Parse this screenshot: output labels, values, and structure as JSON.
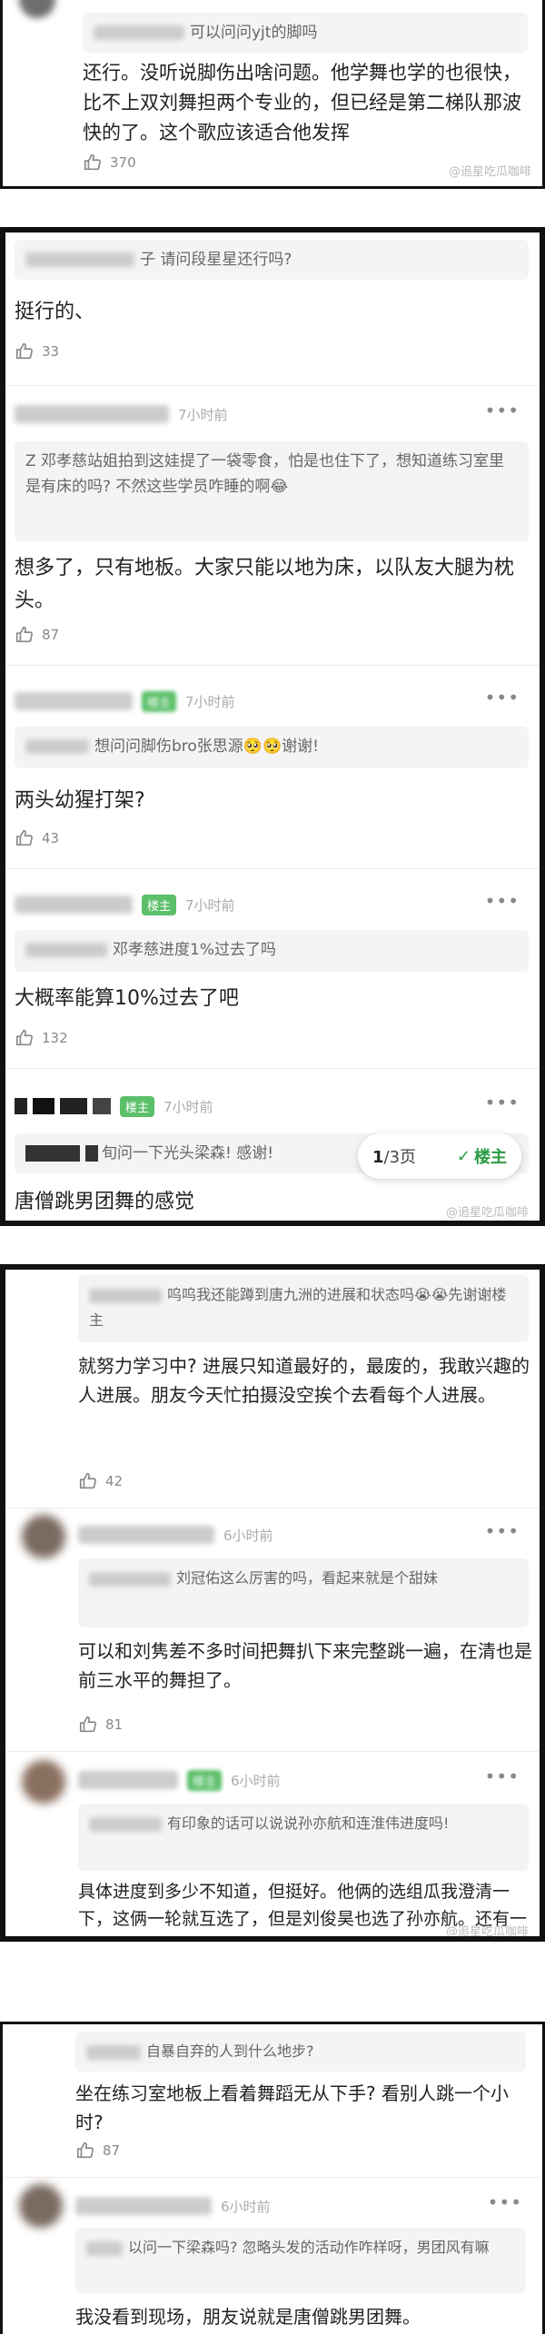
{
  "panel1": {
    "quote": "可以问问yjt的脚吗",
    "reply": "还行。没听说脚伤出啥问题。他学舞也学的也很快，比不上双刘舞担两个专业的，但已经是第二梯队那波快的了。这个歌应该适合他发挥",
    "likes": "370"
  },
  "panel2": {
    "c1": {
      "quote": "子 请问段星星还行吗?",
      "reply": "挺行的、",
      "likes": "33"
    },
    "c2": {
      "time": "7小时前",
      "quote": "Z 邓孝慈站姐拍到这娃提了一袋零食，怕是也住下了，想知道练习室里是有床的吗? 不然这些学员咋睡的啊😂",
      "reply": "想多了，只有地板。大家只能以地为床，以队友大腿为枕头。",
      "likes": "87"
    },
    "c3": {
      "badge": "楼主",
      "time": "7小时前",
      "quote": "想问问脚伤bro张思源🥺🥺谢谢!",
      "reply": "两头幼猩打架?",
      "likes": "43"
    },
    "c4": {
      "badge": "楼主",
      "time": "7小时前",
      "quote": "邓孝慈进度1%过去了吗",
      "reply": "大概率能算10%过去了吧",
      "likes": "132"
    },
    "c5": {
      "badge": "楼主",
      "time": "7小时前",
      "quote": "旬问一下光头梁森! 感谢!",
      "reply": "唐僧跳男团舞的感觉"
    },
    "pager": {
      "page": "1",
      "total": "/3页",
      "owner": "楼主",
      "check": "✓"
    }
  },
  "panel3": {
    "c1": {
      "quote": "呜呜我还能蹲到唐九洲的进展和状态吗😭😭先谢谢楼主",
      "reply": "就努力学习中? 进展只知道最好的，最废的，我敢兴趣的人进展。朋友今天忙拍摄没空挨个去看每个人进展。",
      "likes": "42"
    },
    "c2": {
      "time": "6小时前",
      "quote": "刘冠佑这么厉害的吗，看起来就是个甜妹",
      "reply": "可以和刘隽差不多时间把舞扒下来完整跳一遍，在清也是前三水平的舞担了。",
      "likes": "81"
    },
    "c3": {
      "badge": "楼主",
      "time": "6小时前",
      "quote": "有印象的话可以说说孙亦航和连淮伟进度吗!",
      "reply": "具体进度到多少不知道，但挺好。他俩的选组瓜我澄清一下，这俩一轮就互选了，但是刘俊昊也选了孙亦航。还有一个人也选了连淮伟。所以说现在是舞担和舞担的抱团，大家事业心好重，好几个组队都是舞担和舞担抱团互助。"
    }
  },
  "panel4": {
    "c1": {
      "quote": "自暴自弃的人到什么地步?",
      "reply": "坐在练习室地板上看着舞蹈无从下手? 看别人跳一个小时?",
      "likes": "87"
    },
    "c2": {
      "time": "6小时前",
      "quote": "以问一下梁森吗? 忽略头发的活动作咋样呀，男团风有嘛",
      "reply": "我没看到现场，朋友说就是唐僧跳男团舞。"
    }
  },
  "watermark": "@追星吃瓜咖啡"
}
